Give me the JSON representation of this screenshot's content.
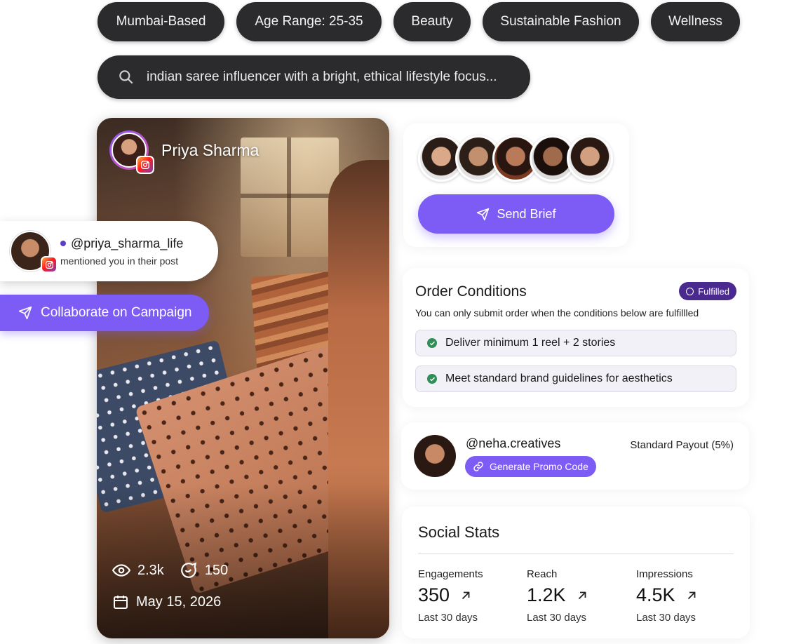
{
  "filters": [
    "Mumbai-Based",
    "Age Range: 25-35",
    "Beauty",
    "Sustainable Fashion",
    "Wellness"
  ],
  "search": {
    "query": "indian saree influencer with a bright, ethical lifestyle focus..."
  },
  "post": {
    "author": "Priya Sharma",
    "views": "2.3k",
    "comments": "150",
    "date": "May 15, 2026"
  },
  "mention": {
    "handle": "@priya_sharma_life",
    "text": "mentioned you in their post"
  },
  "collaborate_label": "Collaborate on Campaign",
  "team": {
    "send_brief_label": "Send Brief"
  },
  "order_conditions": {
    "title": "Order Conditions",
    "status": "Fulfilled",
    "description": "You can only submit order when the conditions below are fulfillled",
    "conditions": [
      "Deliver minimum 1 reel + 2 stories",
      "Meet standard brand guidelines for aesthetics"
    ]
  },
  "promo": {
    "handle": "@neha.creatives",
    "button_label": "Generate Promo Code",
    "payout": "Standard Payout (5%)"
  },
  "social_stats": {
    "title": "Social Stats",
    "stats": [
      {
        "label": "Engagements",
        "value": "350",
        "period": "Last 30 days"
      },
      {
        "label": "Reach",
        "value": "1.2K",
        "period": "Last 30 days"
      },
      {
        "label": "Impressions",
        "value": "4.5K",
        "period": "Last 30 days"
      }
    ]
  },
  "colors": {
    "accent": "#7c5cf5",
    "chip_bg": "#2b2b2d",
    "badge_bg": "#4b2a8f",
    "check": "#2f8f56"
  }
}
